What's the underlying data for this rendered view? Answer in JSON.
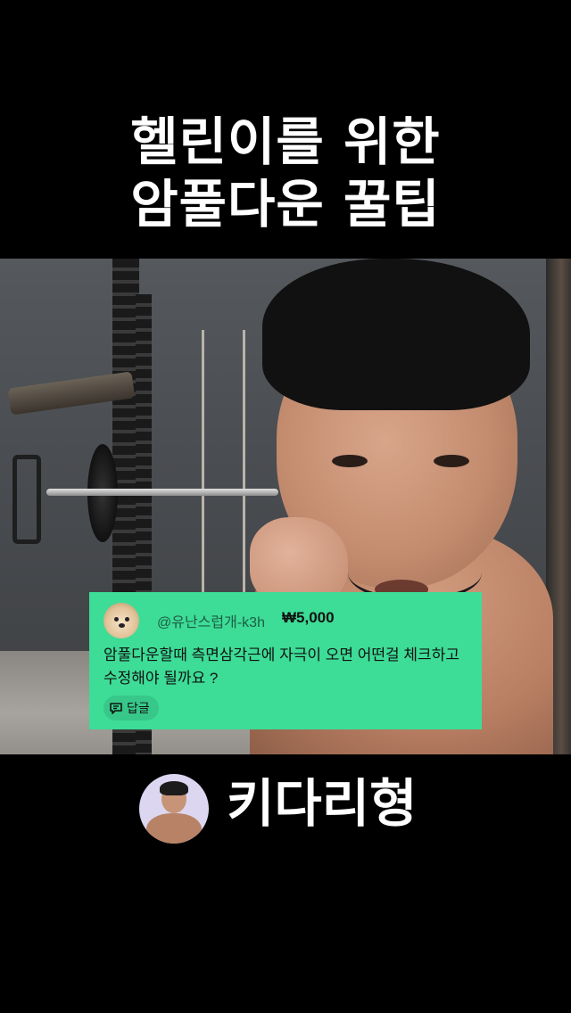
{
  "title": {
    "line1": "헬린이를 위한",
    "line2": "암풀다운 꿀팁"
  },
  "comment": {
    "username": "@유난스럽개-k3h",
    "amount": "₩5,000",
    "text": "암풀다운할때 측면삼각근에 자극이 오면 어떤걸 체크하고 수정해야 될까요 ?",
    "reply_label": "답글",
    "accent_color": "#3ddc97"
  },
  "channel": {
    "name": "키다리형"
  }
}
